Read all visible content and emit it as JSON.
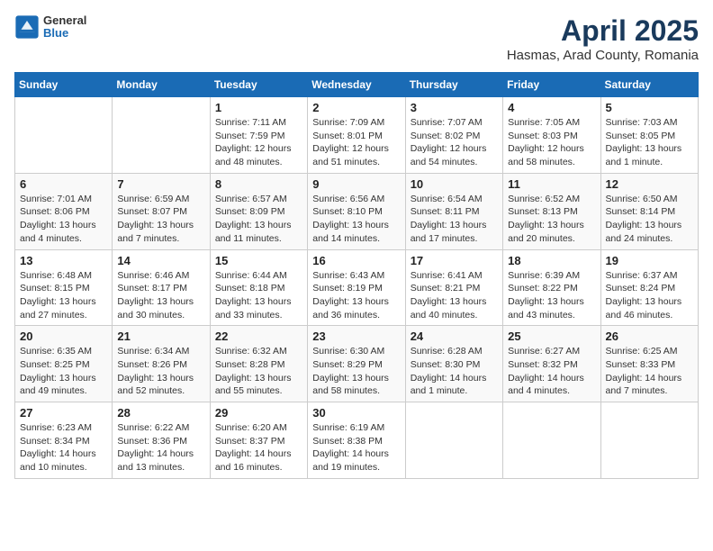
{
  "header": {
    "logo": {
      "general": "General",
      "blue": "Blue"
    },
    "title": "April 2025",
    "subtitle": "Hasmas, Arad County, Romania"
  },
  "calendar": {
    "weekdays": [
      "Sunday",
      "Monday",
      "Tuesday",
      "Wednesday",
      "Thursday",
      "Friday",
      "Saturday"
    ],
    "weeks": [
      [
        {
          "day": "",
          "info": ""
        },
        {
          "day": "",
          "info": ""
        },
        {
          "day": "1",
          "info": "Sunrise: 7:11 AM\nSunset: 7:59 PM\nDaylight: 12 hours and 48 minutes."
        },
        {
          "day": "2",
          "info": "Sunrise: 7:09 AM\nSunset: 8:01 PM\nDaylight: 12 hours and 51 minutes."
        },
        {
          "day": "3",
          "info": "Sunrise: 7:07 AM\nSunset: 8:02 PM\nDaylight: 12 hours and 54 minutes."
        },
        {
          "day": "4",
          "info": "Sunrise: 7:05 AM\nSunset: 8:03 PM\nDaylight: 12 hours and 58 minutes."
        },
        {
          "day": "5",
          "info": "Sunrise: 7:03 AM\nSunset: 8:05 PM\nDaylight: 13 hours and 1 minute."
        }
      ],
      [
        {
          "day": "6",
          "info": "Sunrise: 7:01 AM\nSunset: 8:06 PM\nDaylight: 13 hours and 4 minutes."
        },
        {
          "day": "7",
          "info": "Sunrise: 6:59 AM\nSunset: 8:07 PM\nDaylight: 13 hours and 7 minutes."
        },
        {
          "day": "8",
          "info": "Sunrise: 6:57 AM\nSunset: 8:09 PM\nDaylight: 13 hours and 11 minutes."
        },
        {
          "day": "9",
          "info": "Sunrise: 6:56 AM\nSunset: 8:10 PM\nDaylight: 13 hours and 14 minutes."
        },
        {
          "day": "10",
          "info": "Sunrise: 6:54 AM\nSunset: 8:11 PM\nDaylight: 13 hours and 17 minutes."
        },
        {
          "day": "11",
          "info": "Sunrise: 6:52 AM\nSunset: 8:13 PM\nDaylight: 13 hours and 20 minutes."
        },
        {
          "day": "12",
          "info": "Sunrise: 6:50 AM\nSunset: 8:14 PM\nDaylight: 13 hours and 24 minutes."
        }
      ],
      [
        {
          "day": "13",
          "info": "Sunrise: 6:48 AM\nSunset: 8:15 PM\nDaylight: 13 hours and 27 minutes."
        },
        {
          "day": "14",
          "info": "Sunrise: 6:46 AM\nSunset: 8:17 PM\nDaylight: 13 hours and 30 minutes."
        },
        {
          "day": "15",
          "info": "Sunrise: 6:44 AM\nSunset: 8:18 PM\nDaylight: 13 hours and 33 minutes."
        },
        {
          "day": "16",
          "info": "Sunrise: 6:43 AM\nSunset: 8:19 PM\nDaylight: 13 hours and 36 minutes."
        },
        {
          "day": "17",
          "info": "Sunrise: 6:41 AM\nSunset: 8:21 PM\nDaylight: 13 hours and 40 minutes."
        },
        {
          "day": "18",
          "info": "Sunrise: 6:39 AM\nSunset: 8:22 PM\nDaylight: 13 hours and 43 minutes."
        },
        {
          "day": "19",
          "info": "Sunrise: 6:37 AM\nSunset: 8:24 PM\nDaylight: 13 hours and 46 minutes."
        }
      ],
      [
        {
          "day": "20",
          "info": "Sunrise: 6:35 AM\nSunset: 8:25 PM\nDaylight: 13 hours and 49 minutes."
        },
        {
          "day": "21",
          "info": "Sunrise: 6:34 AM\nSunset: 8:26 PM\nDaylight: 13 hours and 52 minutes."
        },
        {
          "day": "22",
          "info": "Sunrise: 6:32 AM\nSunset: 8:28 PM\nDaylight: 13 hours and 55 minutes."
        },
        {
          "day": "23",
          "info": "Sunrise: 6:30 AM\nSunset: 8:29 PM\nDaylight: 13 hours and 58 minutes."
        },
        {
          "day": "24",
          "info": "Sunrise: 6:28 AM\nSunset: 8:30 PM\nDaylight: 14 hours and 1 minute."
        },
        {
          "day": "25",
          "info": "Sunrise: 6:27 AM\nSunset: 8:32 PM\nDaylight: 14 hours and 4 minutes."
        },
        {
          "day": "26",
          "info": "Sunrise: 6:25 AM\nSunset: 8:33 PM\nDaylight: 14 hours and 7 minutes."
        }
      ],
      [
        {
          "day": "27",
          "info": "Sunrise: 6:23 AM\nSunset: 8:34 PM\nDaylight: 14 hours and 10 minutes."
        },
        {
          "day": "28",
          "info": "Sunrise: 6:22 AM\nSunset: 8:36 PM\nDaylight: 14 hours and 13 minutes."
        },
        {
          "day": "29",
          "info": "Sunrise: 6:20 AM\nSunset: 8:37 PM\nDaylight: 14 hours and 16 minutes."
        },
        {
          "day": "30",
          "info": "Sunrise: 6:19 AM\nSunset: 8:38 PM\nDaylight: 14 hours and 19 minutes."
        },
        {
          "day": "",
          "info": ""
        },
        {
          "day": "",
          "info": ""
        },
        {
          "day": "",
          "info": ""
        }
      ]
    ]
  }
}
